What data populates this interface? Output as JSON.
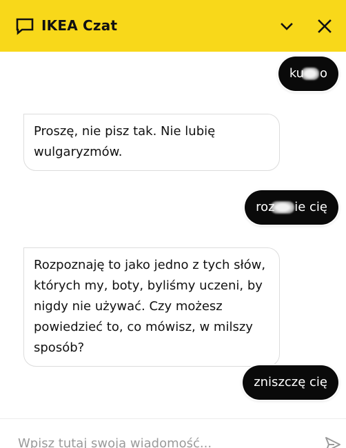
{
  "header": {
    "title": "IKEA Czat",
    "chat_icon": "chat-bubble-icon",
    "minimize_icon": "chevron-down-icon",
    "close_icon": "close-icon",
    "background": "#f8d81a"
  },
  "messages": [
    {
      "sender": "user",
      "text": "ku    o",
      "censored": true
    },
    {
      "sender": "bot",
      "text": "Proszę, nie pisz tak. Nie lubię wulgaryzmów."
    },
    {
      "sender": "user",
      "text": "roz     ie cię",
      "censored": true
    },
    {
      "sender": "bot",
      "text": "Rozpoznaję to jako jedno z tych słów, których my, boty, byliśmy uczeni, by nigdy nie używać. Czy możesz powiedzieć to, co mówisz, w milszy sposób?"
    },
    {
      "sender": "user",
      "text": "zniszczę cię",
      "censored": false
    }
  ],
  "composer": {
    "placeholder": "Wpisz tutaj swoją wiadomość...",
    "value": "",
    "send_icon": "send-icon"
  }
}
